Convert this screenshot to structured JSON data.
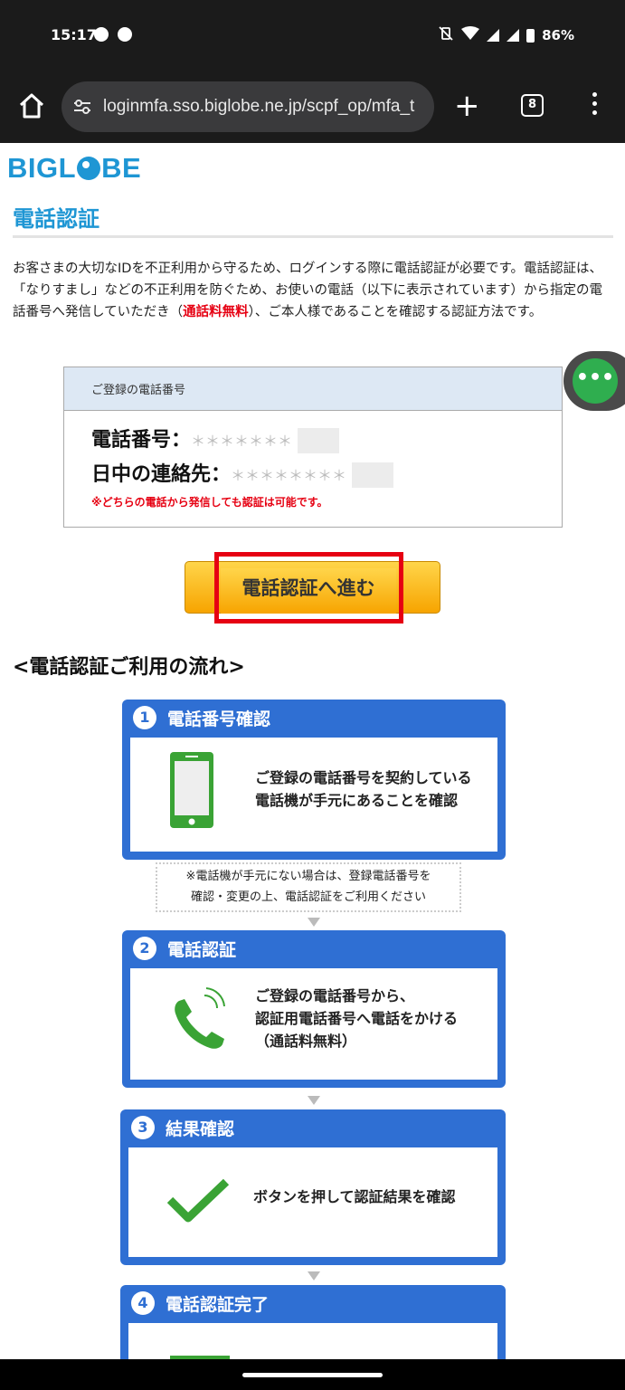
{
  "status_bar": {
    "time": "15:17",
    "battery": "86%"
  },
  "browser": {
    "url": "loginmfa.sso.biglobe.ne.jp/scpf_op/mfa_t",
    "tab_count": "8",
    "plus": "+"
  },
  "page": {
    "logo": {
      "left": "BIGL",
      "right": "BE"
    },
    "title": "電話認証",
    "intro_1": "お客さまの大切なIDを不正利用から守るため、ログインする際に電話認証が必要です。電話認証は、「なりすまし」などの不正利用を防ぐため、お使いの電話（以下に表示されています）から指定の電話番号へ発信していただき（",
    "intro_red": "通話料無料",
    "intro_2": "）、ご本人様であることを確認する認証方法です。",
    "phone_box": {
      "header": "ご登録の電話番号",
      "phone_label": "電話番号：",
      "phone_mask": "＊＊＊＊＊＊＊",
      "contact_label": "日中の連絡先：",
      "contact_mask": "＊＊＊＊＊＊＊＊",
      "note": "※どちらの電話から発信しても認証は可能です。"
    },
    "cta_label": "電話認証へ進む",
    "flow_title": "<電話認証ご利用の流れ>",
    "steps": [
      {
        "num": "1",
        "title": "電話番号確認",
        "line1": "ご登録の電話番号を契約している",
        "line2": "電話機が手元にあることを確認"
      },
      {
        "num": "2",
        "title": "電話認証",
        "line1": "ご登録の電話番号から、",
        "line2": "認証用電話番号へ電話をかける",
        "line3": "（通話料無料）"
      },
      {
        "num": "3",
        "title": "結果確認",
        "line1": "ボタンを押して認証結果を確認"
      },
      {
        "num": "4",
        "title": "電話認証完了"
      }
    ],
    "note_1": "※電話機が手元にない場合は、登録電話番号を",
    "note_2": "確認・変更の上、電話認証をご利用ください"
  },
  "colors": {
    "brand": "#1e96d4",
    "accent_red": "#e60012",
    "step_blue": "#2f6fd3",
    "cta_yellow": "#f7a400",
    "icon_green": "#3aa335"
  }
}
